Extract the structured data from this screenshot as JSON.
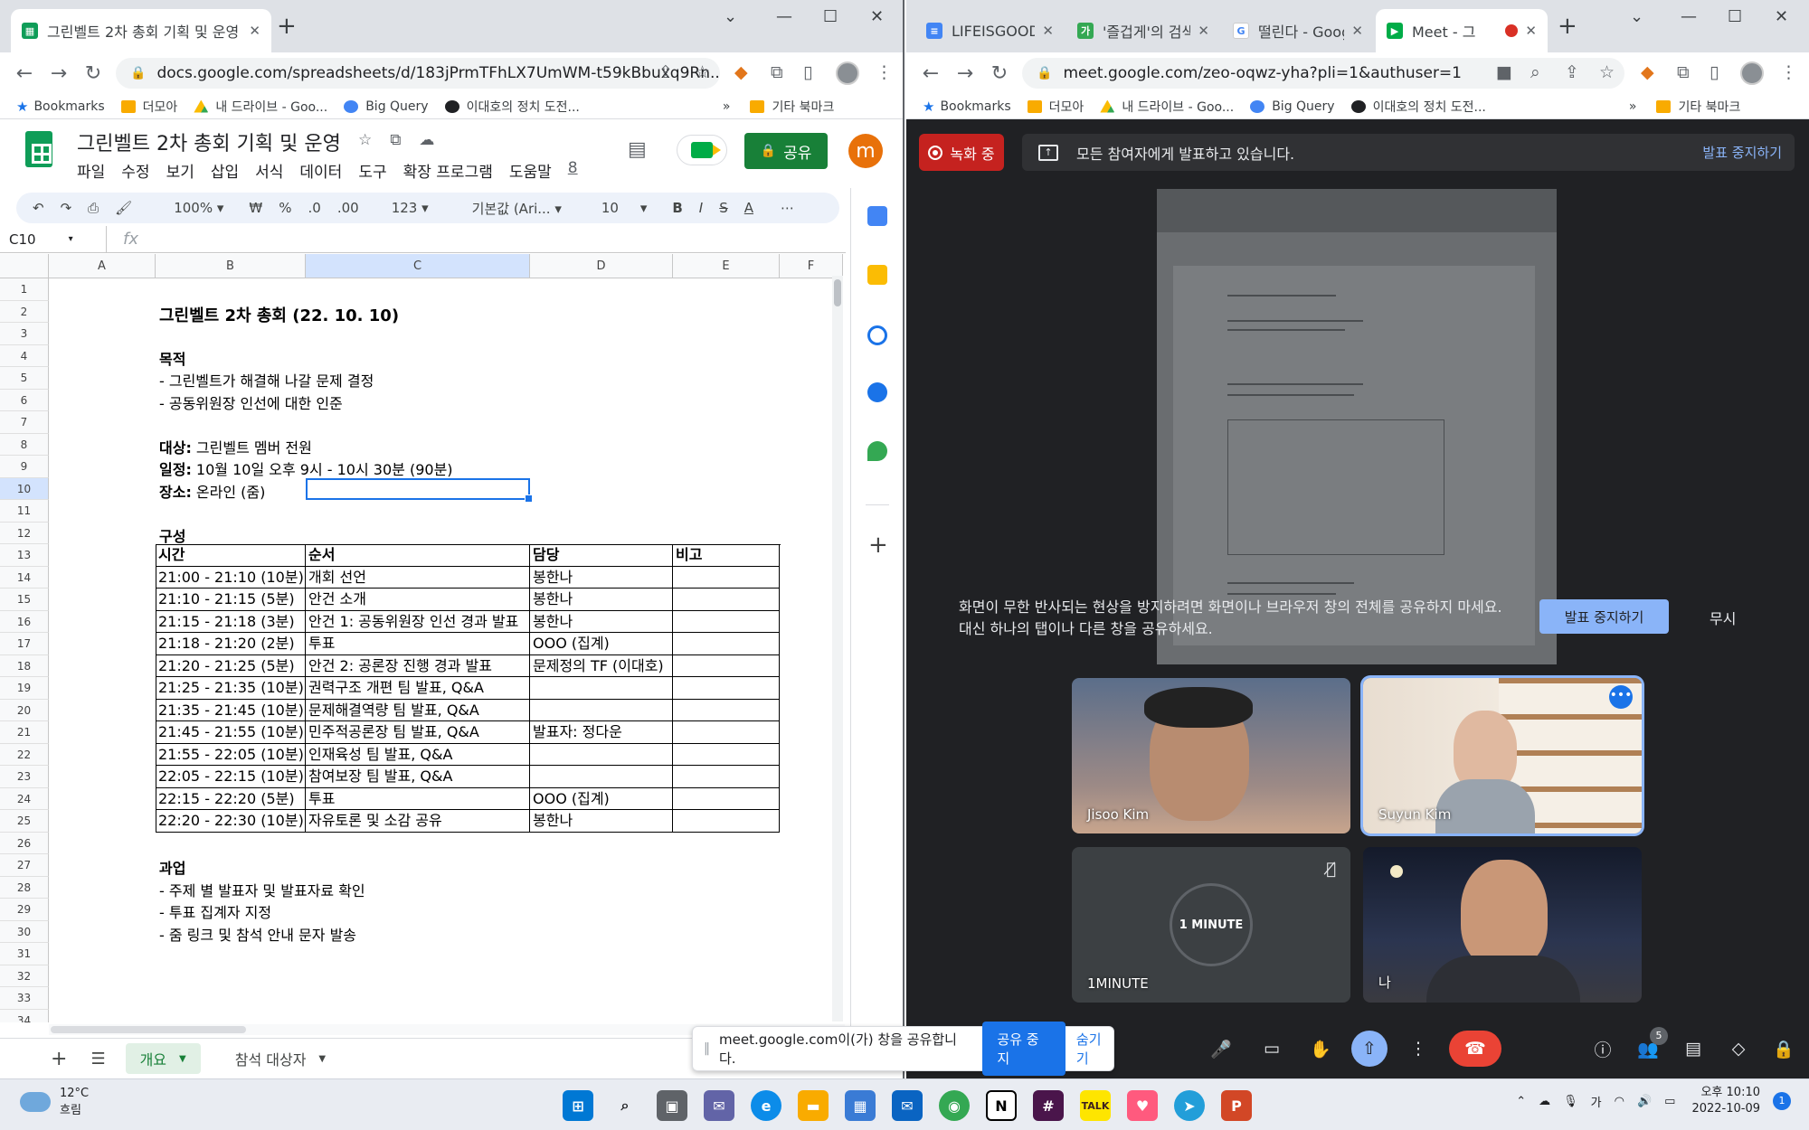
{
  "left_window": {
    "tab_title": "그린벨트 2차 총회 기획 및 운영",
    "url": "docs.google.com/spreadsheets/d/183jPrmTFhLX7UmWM-t59kBbuxq9Rn...",
    "bookmarks": [
      "Bookmarks",
      "더모아",
      "내 드라이브 - Goo...",
      "Big Query",
      "이대호의 정치 도전...",
      "기타 북마크"
    ],
    "doc_title": "그린벨트 2차 총회 기획 및 운영",
    "menus": [
      "파일",
      "수정",
      "보기",
      "삽입",
      "서식",
      "데이터",
      "도구",
      "확장 프로그램",
      "도움말",
      "8"
    ],
    "share_label": "공유",
    "user_initial": "m",
    "toolbar": {
      "zoom": "100%",
      "currency": "₩",
      "percent": "%",
      "dec_less": ".0",
      "dec_more": ".00",
      "format": "123",
      "font": "기본값 (Ari...",
      "size": "10"
    },
    "namebox": "C10",
    "fx": "fx",
    "columns": [
      "A",
      "B",
      "C",
      "D",
      "E",
      "F"
    ],
    "rows": [
      "1",
      "2",
      "3",
      "4",
      "5",
      "6",
      "7",
      "8",
      "9",
      "10",
      "11",
      "12",
      "13",
      "14",
      "15",
      "16",
      "17",
      "18",
      "19",
      "20",
      "21",
      "22",
      "23",
      "24",
      "25",
      "26",
      "27",
      "28",
      "29",
      "30",
      "31",
      "32",
      "33",
      "34"
    ],
    "content": {
      "title": "그린벨트 2차 총회 (22. 10. 10)",
      "purpose_label": "목적",
      "purpose": [
        "- 그린벨트가 해결해 나갈 문제 결정",
        "- 공동위원장 인선에 대한 인준"
      ],
      "target_label": "대상:",
      "target_value": " 그린벨트 멤버 전원",
      "schedule_label": "일정:",
      "schedule_value": " 10월 10일 오후 9시 - 10시 30분 (90분)",
      "place_label": "장소:",
      "place_value": " 온라인 (줌)",
      "structure_label": "구성",
      "tasks_label": "과업",
      "tasks": [
        "- 주제 별 발표자 및 발표자료 확인",
        "- 투표 집계자 지정",
        "- 줌 링크 및 참석 안내 문자 발송"
      ]
    },
    "table": {
      "headers": [
        "시간",
        "순서",
        "담당",
        "비고"
      ],
      "rows": [
        [
          "21:00 - 21:10 (10분)",
          "개회 선언",
          "봉한나",
          ""
        ],
        [
          "21:10 - 21:15 (5분)",
          "안건 소개",
          "봉한나",
          ""
        ],
        [
          "21:15 - 21:18 (3분)",
          "안건 1: 공동위원장 인선 경과 발표",
          "봉한나",
          ""
        ],
        [
          "21:18 - 21:20 (2분)",
          "투표",
          "OOO (집계)",
          ""
        ],
        [
          "21:20 - 21:25 (5분)",
          "안건 2: 공론장 진행 경과 발표",
          "문제정의 TF (이대호)",
          ""
        ],
        [
          "21:25 - 21:35 (10분)",
          "권력구조 개편 팀 발표, Q&A",
          "",
          ""
        ],
        [
          "21:35 - 21:45 (10분)",
          "문제해결역량 팀 발표, Q&A",
          "",
          ""
        ],
        [
          "21:45 - 21:55 (10분)",
          "민주적공론장 팀 발표, Q&A",
          "발표자: 정다운",
          ""
        ],
        [
          "21:55 - 22:05 (10분)",
          "인재육성 팀 발표, Q&A",
          "",
          ""
        ],
        [
          "22:05 - 22:15 (10분)",
          "참여보장 팀 발표, Q&A",
          "",
          ""
        ],
        [
          "22:15 - 22:20 (5분)",
          "투표",
          "OOO (집계)",
          ""
        ],
        [
          "22:20 - 22:30 (10분)",
          "자유토론 및 소감 공유",
          "봉한나",
          ""
        ]
      ]
    },
    "sheet_tabs": [
      "개요",
      "참석 대상자"
    ],
    "share_notice": {
      "text": "meet.google.com이(가) 창을 공유합니다.",
      "stop": "공유 중지",
      "hide": "숨기기"
    }
  },
  "right_window": {
    "tabs": [
      "LIFEISGOODAY",
      "'즐겁게'의 검색",
      "떨린다 - Goog",
      "Meet - 그"
    ],
    "url": "meet.google.com/zeo-oqwz-yha?pli=1&authuser=1",
    "bookmarks": [
      "Bookmarks",
      "더모아",
      "내 드라이브 - Goo...",
      "Big Query",
      "이대호의 정치 도전...",
      "기타 북마크"
    ],
    "recording_label": "녹화 중",
    "presenting_text": "모든 참여자에게 발표하고 있습니다.",
    "stop_presenting_link": "발표 중지하기",
    "warning_line1": "화면이 무한 반사되는 현상을 방지하려면 화면이나 브라우저 창의 전체를 공유하지 마세요.",
    "warning_line2": "대신 하나의 탭이나 다른 창을 공유하세요.",
    "warning_button": "발표 중지하기",
    "ignore_label": "무시",
    "participants": [
      "Jisoo Kim",
      "Suyun Kim",
      "1MINUTE",
      "나"
    ],
    "clock_label": "1 MINUTE",
    "people_count": "5"
  },
  "taskbar": {
    "temp": "12°C",
    "weather": "흐림",
    "ime": "가",
    "time": "오후 10:10",
    "date": "2022-10-09",
    "notif": "1"
  },
  "colors": {
    "sheets_green": "#188038",
    "meet_bg": "#202124",
    "accent_blue": "#1a73e8",
    "rec_red": "#c5221f"
  }
}
